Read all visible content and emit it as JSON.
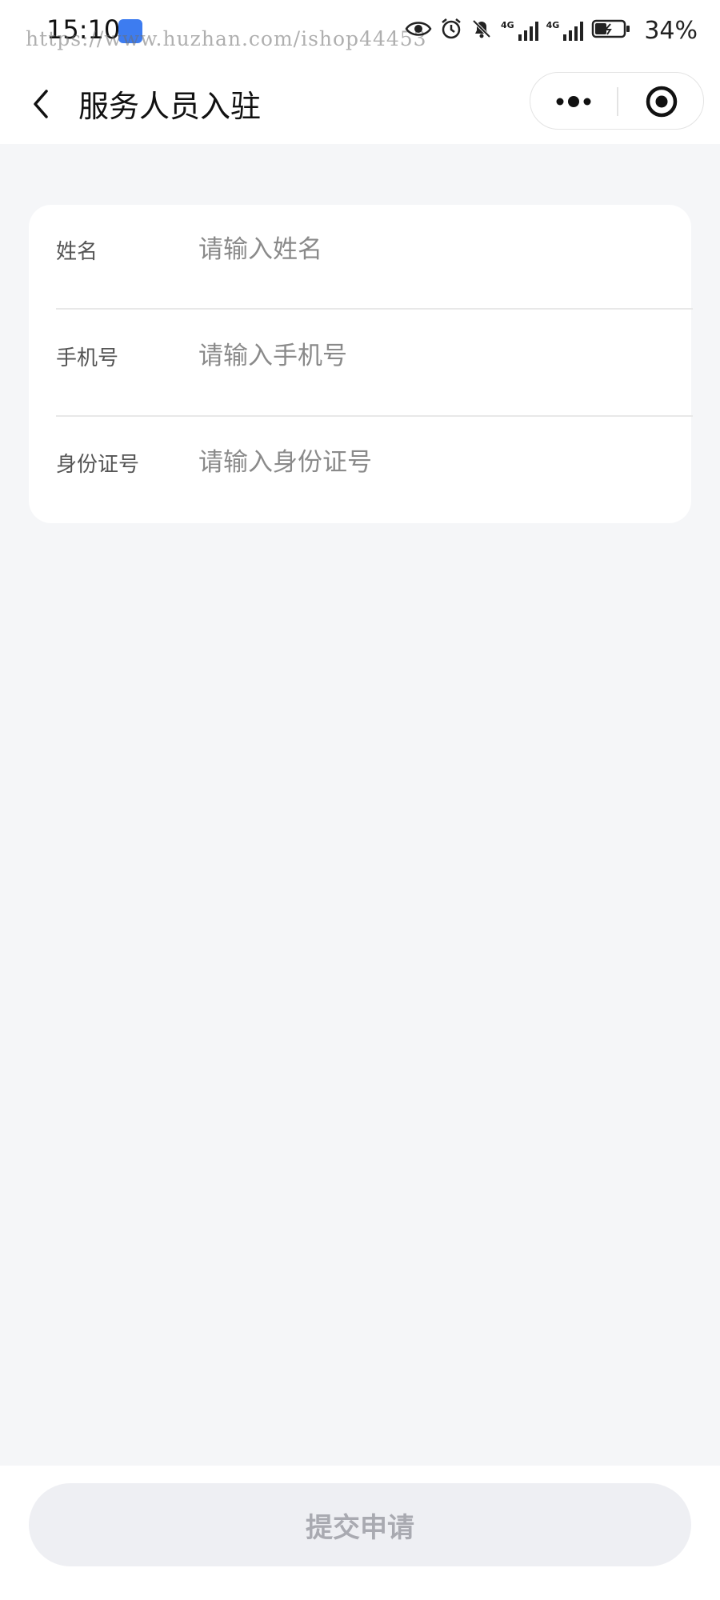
{
  "status_bar": {
    "time": "15:10",
    "watermark": "https://www.huzhan.com/ishop44453",
    "signal_1_label": "4G",
    "signal_2_label": "4G",
    "battery_percent": "34%",
    "icons": [
      "eye-icon",
      "alarm-icon",
      "bell-off-icon",
      "signal-icon",
      "signal-icon",
      "battery-charging-icon"
    ]
  },
  "navbar": {
    "title": "服务人员入驻",
    "back_icon": "chevron-left-icon",
    "more_icon": "more-dots-icon",
    "close_icon": "target-close-icon"
  },
  "form": {
    "fields": [
      {
        "label": "姓名",
        "placeholder": "请输入姓名",
        "value": ""
      },
      {
        "label": "手机号",
        "placeholder": "请输入手机号",
        "value": ""
      },
      {
        "label": "身份证号",
        "placeholder": "请输入身份证号",
        "value": ""
      }
    ]
  },
  "footer": {
    "submit_label": "提交申请"
  },
  "colors": {
    "page_bg": "#f5f6f8",
    "card_bg": "#ffffff",
    "button_bg": "#eeeff3",
    "button_text": "#a9aab1"
  }
}
